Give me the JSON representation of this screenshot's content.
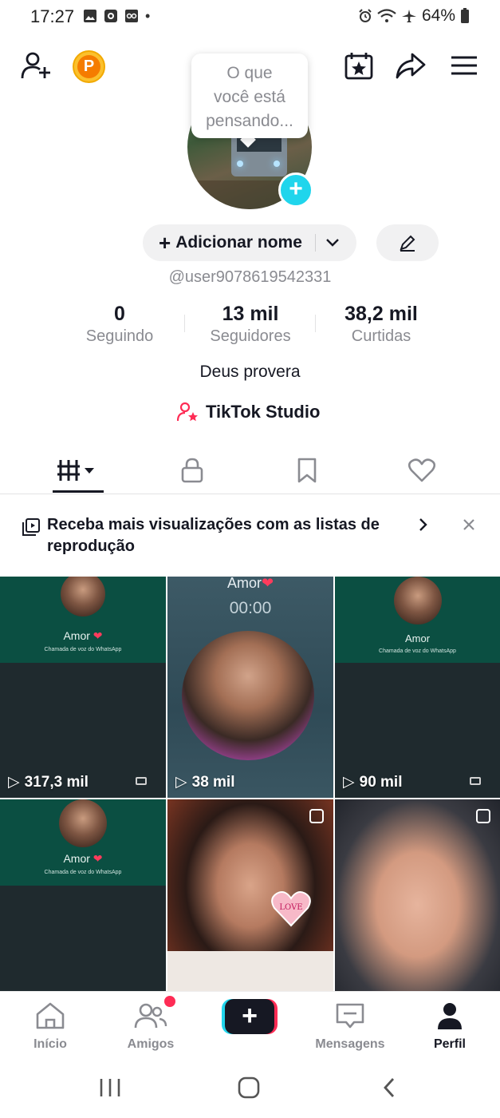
{
  "status_bar": {
    "time": "17:27",
    "dot": "•",
    "battery": "64%"
  },
  "header": {
    "coin_label": "P",
    "bubble_lines": [
      "O que",
      "você está",
      "pensando..."
    ]
  },
  "profile": {
    "add_name": "Adicionar nome",
    "username": "@user9078619542331",
    "stats": [
      {
        "value": "0",
        "label": "Seguindo"
      },
      {
        "value": "13 mil",
        "label": "Seguidores"
      },
      {
        "value": "38,2 mil",
        "label": "Curtidas"
      }
    ],
    "bio": "Deus provera",
    "studio": "TikTok Studio"
  },
  "banner": {
    "text": "Receba mais visualizações com as listas de reprodução"
  },
  "videos": [
    {
      "views": "317,3 mil",
      "overlay_name": "Amor",
      "overlay_sub": "Chamada de voz do WhatsApp"
    },
    {
      "views": "38 mil",
      "overlay_name": "Amor",
      "overlay_timer": "00:00"
    },
    {
      "views": "90 mil",
      "overlay_name": "Amor",
      "overlay_sub": "Chamada de voz do WhatsApp"
    },
    {
      "overlay_name": "Amor",
      "overlay_sub": "Chamada de voz do WhatsApp"
    },
    {
      "sticker": "LOVE"
    },
    {}
  ],
  "bottom_nav": {
    "items": [
      {
        "label": "Início",
        "icon": "home-icon"
      },
      {
        "label": "Amigos",
        "icon": "friends-icon"
      },
      {
        "label": "Mensagens",
        "icon": "inbox-icon"
      },
      {
        "label": "Perfil",
        "icon": "profile-icon"
      }
    ]
  },
  "colors": {
    "accent_cyan": "#20d5ec",
    "accent_red": "#fe2c55",
    "text": "#161823",
    "muted": "#8a8b91"
  }
}
